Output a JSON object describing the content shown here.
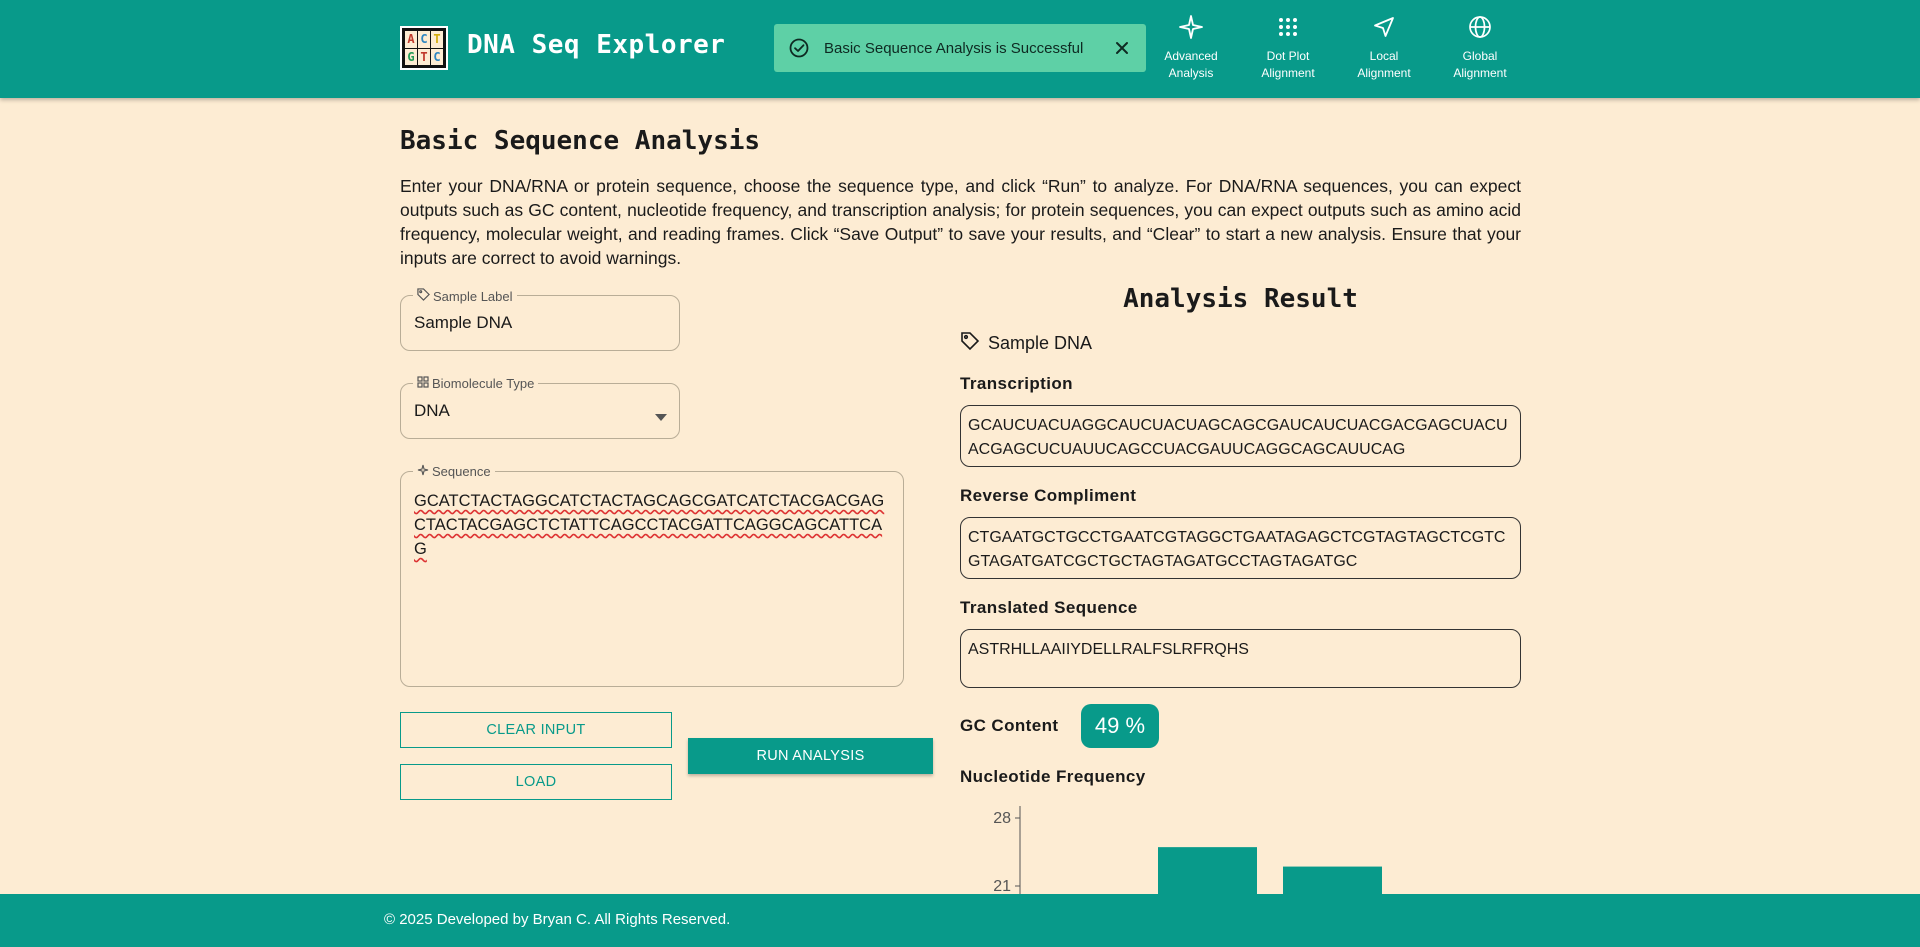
{
  "header": {
    "logo_letters": [
      "A",
      "C",
      "T",
      "G",
      "T",
      "C"
    ],
    "title": "DNA Seq Explorer",
    "toast": {
      "message": "Basic Sequence Analysis is Successful"
    },
    "nav": [
      {
        "label_line1": "Advanced",
        "label_line2": "Analysis",
        "icon": "sparkle-icon"
      },
      {
        "label_line1": "Dot Plot",
        "label_line2": "Alignment",
        "icon": "grid-dots-icon"
      },
      {
        "label_line1": "Local",
        "label_line2": "Alignment",
        "icon": "navigation-arrow-icon"
      },
      {
        "label_line1": "Global",
        "label_line2": "Alignment",
        "icon": "globe-icon"
      }
    ]
  },
  "page": {
    "title": "Basic Sequence Analysis",
    "intro": "Enter your DNA/RNA or protein sequence, choose the sequence type, and click “Run” to analyze. For DNA/RNA sequences, you can expect outputs such as GC content, nucleotide frequency, and transcription analysis; for protein sequences, you can expect outputs such as amino acid frequency, molecular weight, and reading frames. Click “Save Output” to save your results, and “Clear” to start a new analysis. Ensure that your inputs are correct to avoid warnings."
  },
  "form": {
    "sample_label": {
      "legend": "Sample Label",
      "value": "Sample DNA"
    },
    "biomolecule_type": {
      "legend": "Biomolecule Type",
      "value": "DNA"
    },
    "sequence": {
      "legend": "Sequence",
      "value": "GCATCTACTAGGCATCTACTAGCAGCGATCATCTACGACGAGCTACTACGAGCTCTATTCAGCCTACGATTCAGGCAGCATTCAG"
    },
    "buttons": {
      "clear": "CLEAR INPUT",
      "load": "LOAD",
      "run": "RUN ANALYSIS"
    }
  },
  "result": {
    "title": "Analysis Result",
    "sample_label": "Sample DNA",
    "transcription_label": "Transcription",
    "transcription": "GCAUCUACUAGGCAUCUACUAGCAGCGAUCAUCUACGACGAGCUACUACGAGCUCUAUUCAGCCUACGAUUCAGGCAGCAUUCAG",
    "reverse_label": "Reverse Compliment",
    "reverse": "CTGAATGCTGCCTGAATCGTAGGCTGAATAGAGCTCGTAGTAGCTCGTCGTAGATGATCGCTGCTAGTAGATGCCTAGTAGATGC",
    "translated_label": "Translated Sequence",
    "translated": "ASTRHLLAAIIYDELLRALFSLRFRQHS",
    "gc_label": "GC Content",
    "gc_value": "49 %",
    "nucleotide_label": "Nucleotide Frequency"
  },
  "chart_data": {
    "type": "bar",
    "title": "Nucleotide Frequency",
    "y_ticks": [
      21,
      28
    ],
    "values": [
      25,
      23
    ],
    "note": "only the upper part of the chart is visible; categories are not visible"
  },
  "colors": {
    "primary": "#089a8a",
    "background": "#fdecd3",
    "toast": "#5ed0a6"
  },
  "footer": {
    "copyright": "© 2025 Developed by Bryan C. All Rights Reserved."
  }
}
